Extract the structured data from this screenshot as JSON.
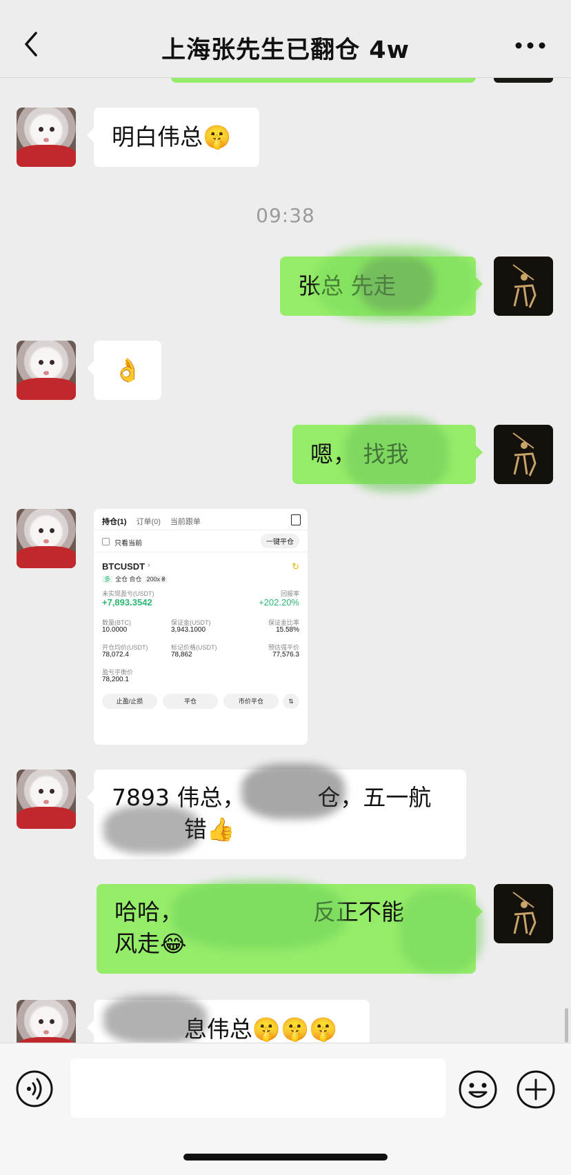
{
  "header": {
    "title": "上海张先生已翻仓 4w"
  },
  "timestamp": "09:38",
  "messages": {
    "m1": "明白伟总🤫",
    "m2": "张总 先走",
    "m3": "👌",
    "m4": "嗯，        找我",
    "m6_line1": "7893 伟总，          仓，五一航",
    "m6_line2": "          错👍",
    "m7_line1": "哈哈，                  反正不能",
    "m7_line2": "风走😂",
    "m8": "          息伟总🤫🤫🤫"
  },
  "card": {
    "tabs": [
      "持仓(1)",
      "订单(0)",
      "当前跟单"
    ],
    "only_current": "只看当前",
    "close_all": "一键平仓",
    "symbol": "BTCUSDT",
    "tag_long": "多",
    "tag_mode": "全仓 合仓",
    "tag_leverage": "200x ₴",
    "pnl_label": "未实现盈亏(USDT)",
    "pnl_value": "+7,893.3542",
    "roe_label": "回报率",
    "roe_value": "+202.20%",
    "qty_label": "数量(BTC)",
    "qty_value": "10.0000",
    "margin_label": "保证金(USDT)",
    "margin_value": "3,943.1000",
    "margin_ratio_label": "保证金比率",
    "margin_ratio_value": "15.58%",
    "entry_label": "开仓均价(USDT)",
    "entry_value": "78,072.4",
    "mark_label": "标记价格(USDT)",
    "mark_value": "78,862",
    "liq_label": "预估强平价",
    "liq_value": "77,576.3",
    "breakeven_label": "盈亏平衡价",
    "breakeven_value": "78,200.1",
    "btn_tpsl": "止盈/止损",
    "btn_close": "平仓",
    "btn_market_close": "市价平仓"
  },
  "colors": {
    "chat_bg": "#ededed",
    "my_bubble": "#95ec69",
    "their_bubble": "#ffffff"
  }
}
